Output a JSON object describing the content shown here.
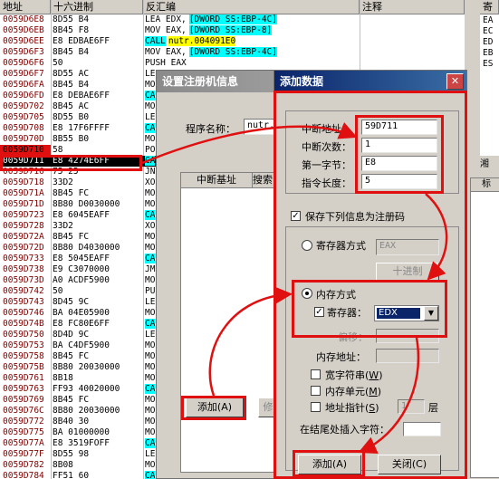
{
  "grid_headers": {
    "address": "地址",
    "hex": "十六进制",
    "disasm": "反汇编",
    "comment": "注释",
    "reg": "寄"
  },
  "rows": [
    {
      "addr": "0059D6E8",
      "hex": "8D55 B4",
      "dis": "LEA EDX,",
      "dis2": "[DWORD SS:EBP-4C]"
    },
    {
      "addr": "0059D6EB",
      "hex": "8B45 F8",
      "dis": "MOV EAX,",
      "dis2": "[DWORD SS:EBP-8]"
    },
    {
      "addr": "0059D6EE",
      "hex": "E8 EDBAE6FF",
      "dis": "CALL",
      "dis2": "nutr.004091E0"
    },
    {
      "addr": "0059D6F3",
      "hex": "8B45 B4",
      "dis": "MOV EAX,",
      "dis2": "[DWORD SS:EBP-4C]"
    },
    {
      "addr": "0059D6F6",
      "hex": "50",
      "dis": "PUSH EAX",
      "dis2": ""
    },
    {
      "addr": "0059D6F7",
      "hex": "8D55 AC",
      "dis": "LE",
      "dis2": ""
    },
    {
      "addr": "0059D6FA",
      "hex": "8B45 B4",
      "dis": "MO",
      "dis2": ""
    },
    {
      "addr": "0059D6FD",
      "hex": "E8 DEBAE6FF",
      "dis": "CA",
      "dis2": ""
    },
    {
      "addr": "0059D702",
      "hex": "8B45 AC",
      "dis": "MO",
      "dis2": ""
    },
    {
      "addr": "0059D705",
      "hex": "8D55 B0",
      "dis": "LE",
      "dis2": ""
    },
    {
      "addr": "0059D708",
      "hex": "E8 17F6FFFF",
      "dis": "CA",
      "dis2": ""
    },
    {
      "addr": "0059D70D",
      "hex": "8B55 B0",
      "dis": "MO",
      "dis2": ""
    },
    {
      "addr": "0059D710",
      "hex": "58",
      "dis": "PO",
      "dis2": ""
    },
    {
      "addr": "0059D711",
      "hex": "E8 4274E6FF",
      "dis": "CA",
      "dis2": ""
    },
    {
      "addr": "0059D716",
      "hex": "75 25",
      "dis": "JN",
      "dis2": ""
    },
    {
      "addr": "0059D718",
      "hex": "33D2",
      "dis": "XO",
      "dis2": ""
    },
    {
      "addr": "0059D71A",
      "hex": "8B45 FC",
      "dis": "MO",
      "dis2": ""
    },
    {
      "addr": "0059D71D",
      "hex": "8B80 D0030000",
      "dis": "MO",
      "dis2": ""
    },
    {
      "addr": "0059D723",
      "hex": "E8 6045EAFF",
      "dis": "CA",
      "dis2": ""
    },
    {
      "addr": "0059D728",
      "hex": "33D2",
      "dis": "XO",
      "dis2": ""
    },
    {
      "addr": "0059D72A",
      "hex": "8B45 FC",
      "dis": "MO",
      "dis2": ""
    },
    {
      "addr": "0059D72D",
      "hex": "8B80 D4030000",
      "dis": "MO",
      "dis2": ""
    },
    {
      "addr": "0059D733",
      "hex": "E8 5045EAFF",
      "dis": "CA",
      "dis2": ""
    },
    {
      "addr": "0059D738",
      "hex": "E9 C3070000",
      "dis": "JM",
      "dis2": ""
    },
    {
      "addr": "0059D73D",
      "hex": "A0 ACDF5900",
      "dis": "MO",
      "dis2": ""
    },
    {
      "addr": "0059D742",
      "hex": "50",
      "dis": "PU",
      "dis2": ""
    },
    {
      "addr": "0059D743",
      "hex": "8D45 9C",
      "dis": "LE",
      "dis2": ""
    },
    {
      "addr": "0059D746",
      "hex": "BA 04E05900",
      "dis": "MO",
      "dis2": ""
    },
    {
      "addr": "0059D74B",
      "hex": "E8 FC80E6FF",
      "dis": "CA",
      "dis2": ""
    },
    {
      "addr": "0059D750",
      "hex": "8D4D 9C",
      "dis": "LE",
      "dis2": ""
    },
    {
      "addr": "0059D753",
      "hex": "BA C4DF5900",
      "dis": "MO",
      "dis2": ""
    },
    {
      "addr": "0059D758",
      "hex": "8B45 FC",
      "dis": "MO",
      "dis2": ""
    },
    {
      "addr": "0059D75B",
      "hex": "8B80 20030000",
      "dis": "MO",
      "dis2": ""
    },
    {
      "addr": "0059D761",
      "hex": "8B18",
      "dis": "MO",
      "dis2": ""
    },
    {
      "addr": "0059D763",
      "hex": "FF93 40020000",
      "dis": "CA",
      "dis2": ""
    },
    {
      "addr": "0059D769",
      "hex": "8B45 FC",
      "dis": "MO",
      "dis2": ""
    },
    {
      "addr": "0059D76C",
      "hex": "8B80 20030000",
      "dis": "MO",
      "dis2": ""
    },
    {
      "addr": "0059D772",
      "hex": "8B40 30",
      "dis": "MO",
      "dis2": ""
    },
    {
      "addr": "0059D775",
      "hex": "BA 01000000",
      "dis": "MO",
      "dis2": ""
    },
    {
      "addr": "0059D77A",
      "hex": "E8 3519FOFF",
      "dis": "CA",
      "dis2": ""
    },
    {
      "addr": "0059D77F",
      "hex": "8D55 98",
      "dis": "LE",
      "dis2": ""
    },
    {
      "addr": "0059D782",
      "hex": "8B08",
      "dis": "MO",
      "dis2": ""
    },
    {
      "addr": "0059D784",
      "hex": "FF51 60",
      "dis": "CA",
      "dis2": ""
    }
  ],
  "reg_col": [
    "EA",
    "EC",
    "ED",
    "EB",
    "ES"
  ],
  "reg_col2": [
    "湘",
    "标"
  ],
  "bg_dialog": {
    "title": "设置注册机信息",
    "program_label": "程序名称：",
    "program_value": "nutr.",
    "col_headers": [
      "中断基址",
      "搜索"
    ],
    "add_btn": "添加(A)",
    "mod_btn": "修"
  },
  "dialog": {
    "title": "添加数据",
    "close_glyph": "✕",
    "labels": {
      "addr": "中断地址：",
      "count": "中断次数：",
      "byte": "第一字节：",
      "len": "指令长度："
    },
    "values": {
      "addr": "59D711",
      "count": "1",
      "byte": "E8",
      "len": "5"
    },
    "save_label": "保存下列信息为注册码",
    "reg_mode": "寄存器方式",
    "reg_mode_value": "EAX",
    "hex_disp": "十进制",
    "mem_mode": "内存方式",
    "reg_label": "寄存器：",
    "reg_value": "EDX",
    "offset_label": "偏移：",
    "mem_addr_label": "内存地址：",
    "wide_label": "宽字符串",
    "wide_key": "W",
    "mem_unit_label": "内存单元",
    "mem_unit_key": "M",
    "ptr_label": "地址指针",
    "ptr_key": "S",
    "ptr_level": "1",
    "layer": "层",
    "insert_label": "在结尾处插入字符：",
    "add_btn": "添加(A)",
    "close_btn": "关闭(C)"
  },
  "colors": {
    "highlight_red": "#e01010",
    "cyan": "#00ffff",
    "yellow": "#ffff00",
    "title_blue": "#0a246a"
  }
}
